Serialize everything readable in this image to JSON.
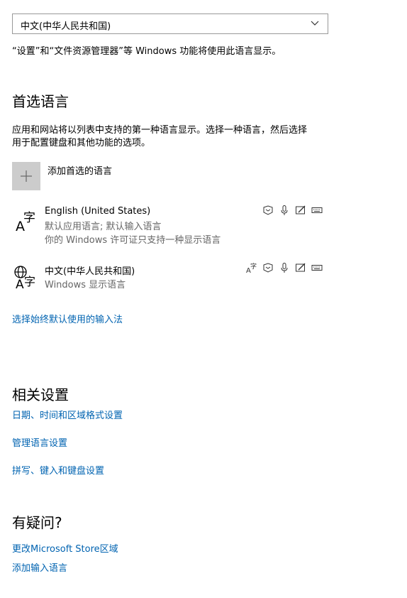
{
  "display_language": {
    "selected": "中文(中华人民共和国)",
    "note": "“设置”和“文件资源管理器”等 Windows 功能将使用此语言显示。"
  },
  "preferred": {
    "heading": "首选语言",
    "description_line1": "应用和网站将以列表中支持的第一种语言显示。选择一种语言，然后选择",
    "description_line2": "用于配置键盘和其他功能的选项。",
    "add_label": "添加首选的语言",
    "languages": [
      {
        "name": "English (United States)",
        "sub1": "默认应用语言; 默认输入语言",
        "sub2": "你的 Windows 许可证只支持一种显示语言",
        "icon": "language-icon",
        "features": [
          "text-to-speech-icon",
          "speech-recognition-icon",
          "handwriting-icon",
          "keyboard-icon"
        ]
      },
      {
        "name": "中文(中华人民共和国)",
        "sub1": "Windows 显示语言",
        "icon": "language-globe-icon",
        "features": [
          "display-language-icon",
          "text-to-speech-icon",
          "speech-recognition-icon",
          "handwriting-icon",
          "keyboard-icon"
        ]
      }
    ],
    "default_input_link": "选择始终默认使用的输入法"
  },
  "related": {
    "heading": "相关设置",
    "links": [
      "日期、时间和区域格式设置",
      "管理语言设置",
      "拼写、键入和键盘设置"
    ]
  },
  "questions": {
    "heading": "有疑问?",
    "links": [
      "更改Microsoft Store区域",
      "添加输入语言"
    ]
  },
  "colors": {
    "link": "#0063b1",
    "button_bg": "#cccccc",
    "secondary_text": "#666666"
  }
}
